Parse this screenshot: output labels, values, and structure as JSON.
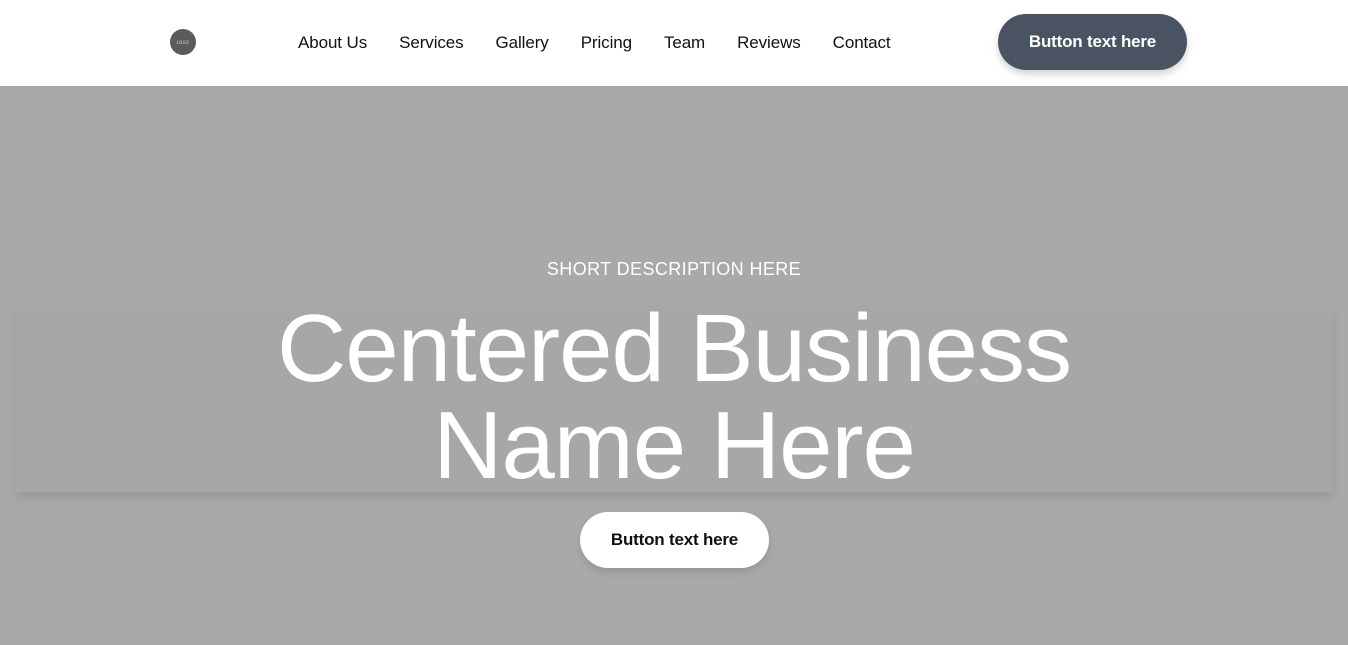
{
  "header": {
    "logo_text": "LOGO",
    "nav": [
      {
        "label": "About Us"
      },
      {
        "label": "Services"
      },
      {
        "label": "Gallery"
      },
      {
        "label": "Pricing"
      },
      {
        "label": "Team"
      },
      {
        "label": "Reviews"
      },
      {
        "label": "Contact"
      }
    ],
    "cta_label": "Button text here"
  },
  "hero": {
    "description": "SHORT DESCRIPTION HERE",
    "title_line1": "Centered Business",
    "title_line2": "Name Here",
    "cta_label": "Button text here"
  },
  "colors": {
    "header_bg": "#ffffff",
    "hero_bg": "#a9a9a9",
    "header_button_bg": "#4a5361",
    "hero_button_bg": "#ffffff",
    "logo_bg": "#5b5b5b"
  }
}
